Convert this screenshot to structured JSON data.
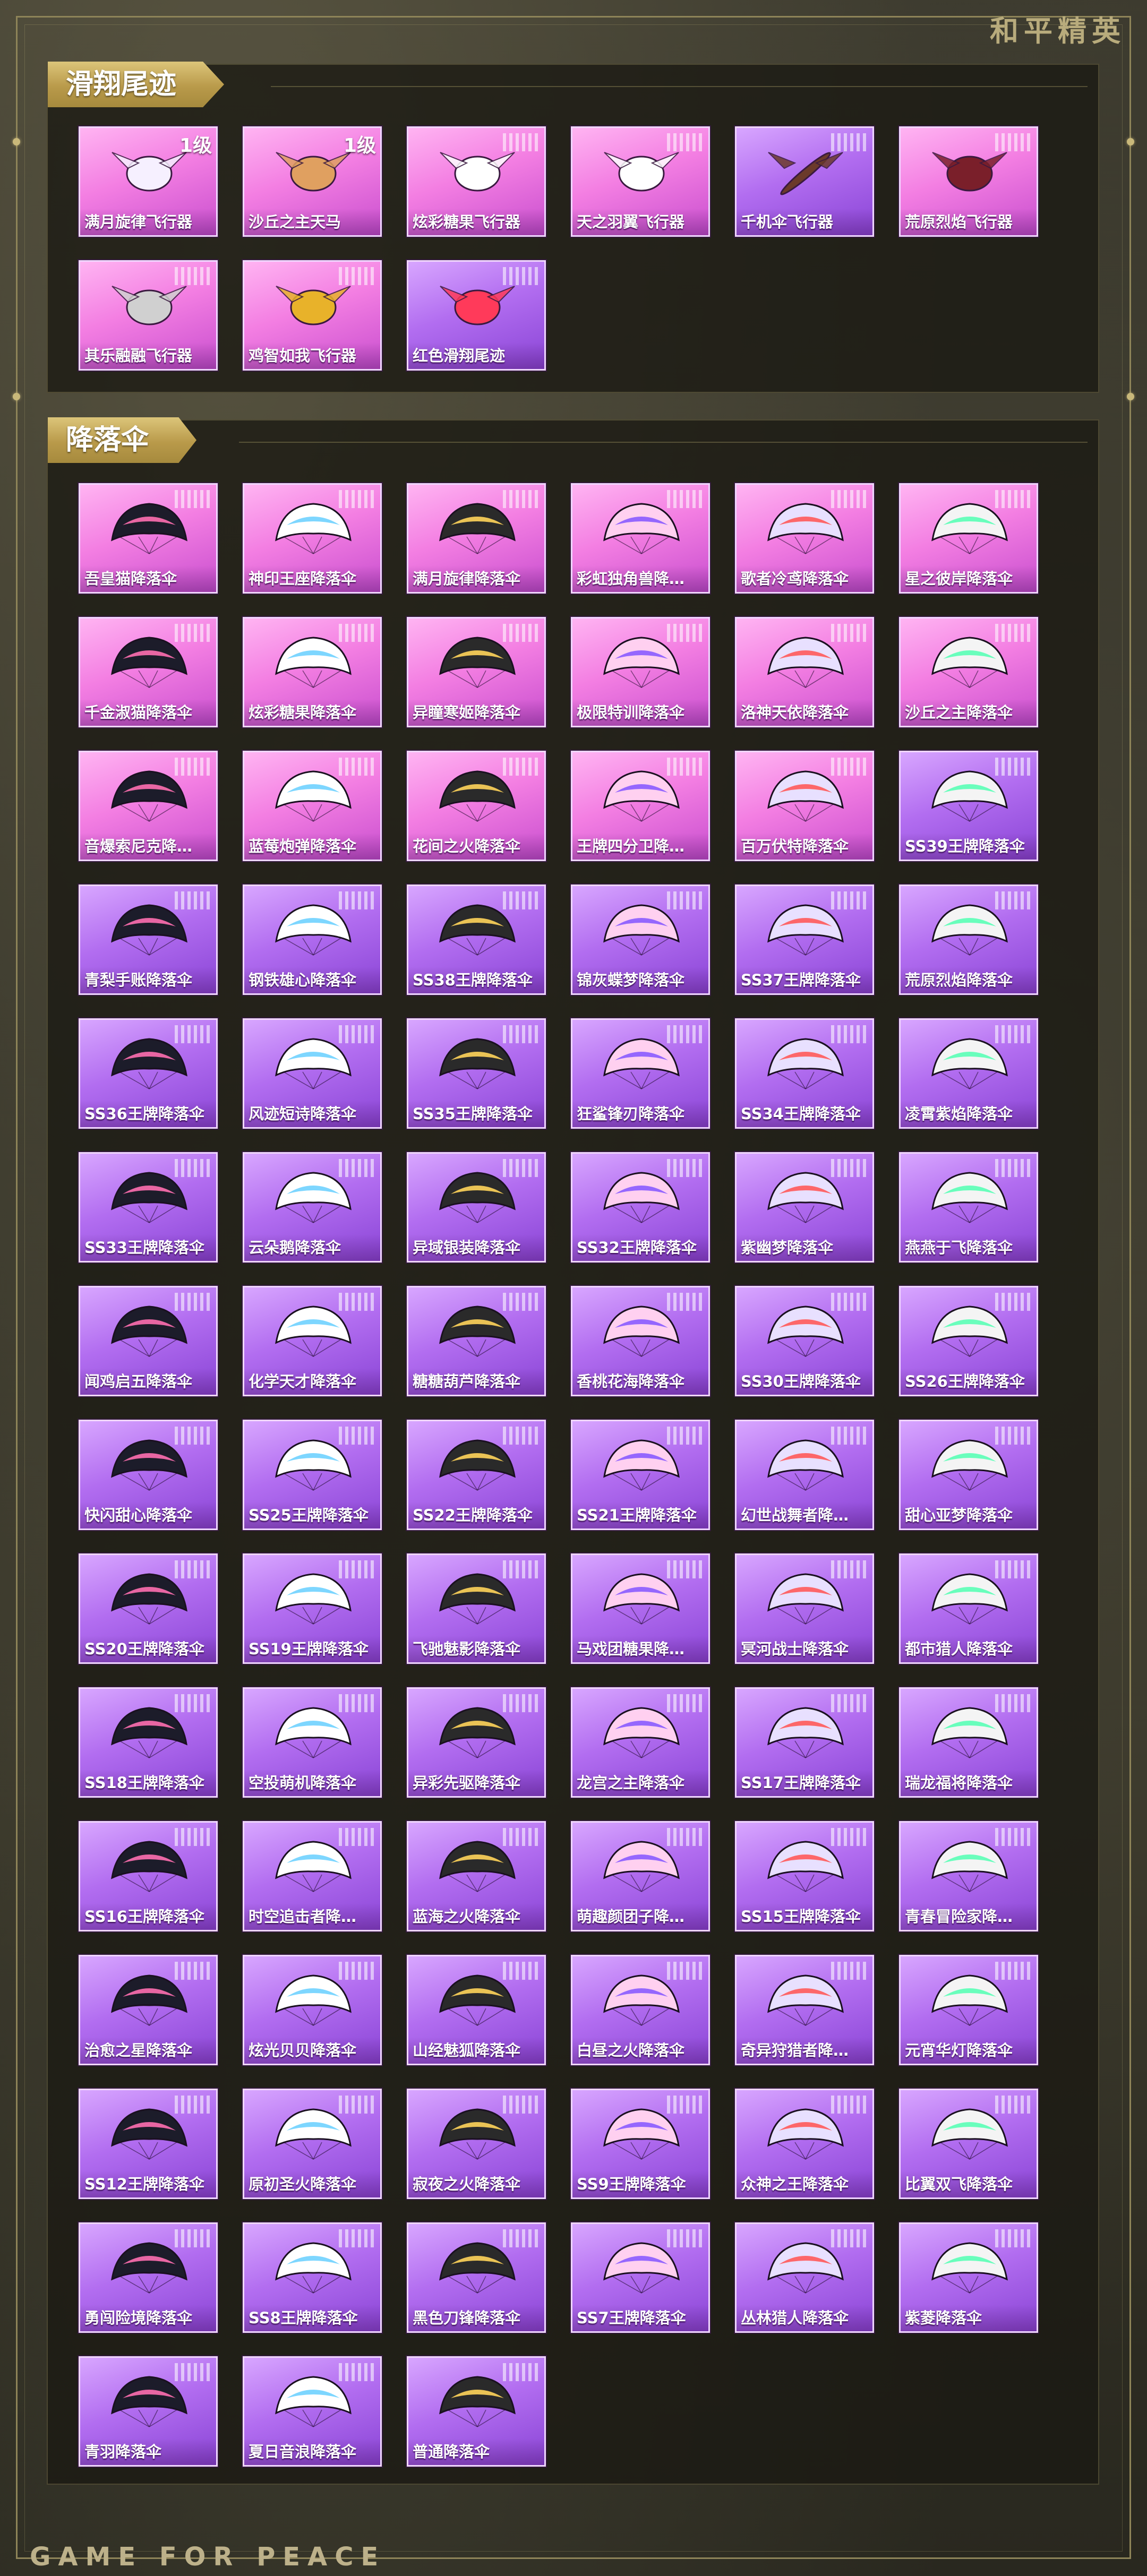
{
  "brand": "和平精英",
  "footer_brand": "GAME FOR PEACE",
  "sections": [
    {
      "title": "滑翔尾迹",
      "items": [
        {
          "name": "满月旋律飞行器",
          "level": "1级",
          "icon": "carriage-glider-icon"
        },
        {
          "name": "沙丘之主天马",
          "level": "1级",
          "icon": "winged-horse-glider-icon"
        },
        {
          "name": "炫彩糖果飞行器",
          "icon": "candy-glider-icon"
        },
        {
          "name": "天之羽翼飞行器",
          "icon": "wing-glider-icon"
        },
        {
          "name": "千机伞飞行器",
          "icon": "umbrella-glider-icon"
        },
        {
          "name": "荒原烈焰飞行器",
          "icon": "flame-glider-icon"
        },
        {
          "name": "其乐融融飞行器",
          "icon": "penguin-glider-icon"
        },
        {
          "name": "鸡智如我飞行器",
          "icon": "chicken-glider-icon"
        },
        {
          "name": "红色滑翔尾迹",
          "icon": "red-trail-icon"
        }
      ]
    },
    {
      "title": "降落伞",
      "items": [
        {
          "name": "吾皇猫降落伞",
          "icon": "parachute-icon"
        },
        {
          "name": "神印王座降落伞",
          "icon": "parachute-icon"
        },
        {
          "name": "满月旋律降落伞",
          "icon": "parachute-icon"
        },
        {
          "name": "彩虹独角兽降…",
          "icon": "parachute-icon"
        },
        {
          "name": "歌者冷鸢降落伞",
          "icon": "parachute-icon"
        },
        {
          "name": "星之彼岸降落伞",
          "icon": "parachute-icon"
        },
        {
          "name": "千金淑猫降落伞",
          "icon": "parachute-icon"
        },
        {
          "name": "炫彩糖果降落伞",
          "icon": "parachute-icon"
        },
        {
          "name": "异瞳寒姬降落伞",
          "icon": "parachute-icon"
        },
        {
          "name": "极限特训降落伞",
          "icon": "parachute-icon"
        },
        {
          "name": "洛神天依降落伞",
          "icon": "parachute-icon"
        },
        {
          "name": "沙丘之主降落伞",
          "icon": "parachute-icon"
        },
        {
          "name": "音爆索尼克降…",
          "icon": "parachute-icon"
        },
        {
          "name": "蓝莓炮弹降落伞",
          "icon": "parachute-icon"
        },
        {
          "name": "花间之火降落伞",
          "icon": "parachute-icon"
        },
        {
          "name": "王牌四分卫降…",
          "icon": "parachute-icon"
        },
        {
          "name": "百万伏特降落伞",
          "icon": "parachute-icon"
        },
        {
          "name": "SS39王牌降落伞",
          "icon": "parachute-icon"
        },
        {
          "name": "青梨手账降落伞",
          "icon": "parachute-icon"
        },
        {
          "name": "钢铁雄心降落伞",
          "icon": "parachute-icon"
        },
        {
          "name": "SS38王牌降落伞",
          "icon": "parachute-icon"
        },
        {
          "name": "锦灰蝶梦降落伞",
          "icon": "parachute-icon"
        },
        {
          "name": "SS37王牌降落伞",
          "icon": "parachute-icon"
        },
        {
          "name": "荒原烈焰降落伞",
          "icon": "parachute-icon"
        },
        {
          "name": "SS36王牌降落伞",
          "icon": "parachute-icon"
        },
        {
          "name": "风迹短诗降落伞",
          "icon": "parachute-icon"
        },
        {
          "name": "SS35王牌降落伞",
          "icon": "parachute-icon"
        },
        {
          "name": "狂鲨锋刃降落伞",
          "icon": "parachute-icon"
        },
        {
          "name": "SS34王牌降落伞",
          "icon": "parachute-icon"
        },
        {
          "name": "凌霄紫焰降落伞",
          "icon": "parachute-icon"
        },
        {
          "name": "SS33王牌降落伞",
          "icon": "parachute-icon"
        },
        {
          "name": "云朵鹅降落伞",
          "icon": "parachute-icon"
        },
        {
          "name": "异域银装降落伞",
          "icon": "parachute-icon"
        },
        {
          "name": "SS32王牌降落伞",
          "icon": "parachute-icon"
        },
        {
          "name": "紫幽梦降落伞",
          "icon": "parachute-icon"
        },
        {
          "name": "燕燕于飞降落伞",
          "icon": "parachute-icon"
        },
        {
          "name": "闻鸡启五降落伞",
          "icon": "parachute-icon"
        },
        {
          "name": "化学天才降落伞",
          "icon": "parachute-icon"
        },
        {
          "name": "糖糖葫芦降落伞",
          "icon": "parachute-icon"
        },
        {
          "name": "香桃花海降落伞",
          "icon": "parachute-icon"
        },
        {
          "name": "SS30王牌降落伞",
          "icon": "parachute-icon"
        },
        {
          "name": "SS26王牌降落伞",
          "icon": "parachute-icon"
        },
        {
          "name": "快闪甜心降落伞",
          "icon": "parachute-icon"
        },
        {
          "name": "SS25王牌降落伞",
          "icon": "parachute-icon"
        },
        {
          "name": "SS22王牌降落伞",
          "icon": "parachute-icon"
        },
        {
          "name": "SS21王牌降落伞",
          "icon": "parachute-icon"
        },
        {
          "name": "幻世战舞者降…",
          "icon": "parachute-icon"
        },
        {
          "name": "甜心亚梦降落伞",
          "icon": "parachute-icon"
        },
        {
          "name": "SS20王牌降落伞",
          "icon": "parachute-icon"
        },
        {
          "name": "SS19王牌降落伞",
          "icon": "parachute-icon"
        },
        {
          "name": "飞驰魅影降落伞",
          "icon": "parachute-icon"
        },
        {
          "name": "马戏团糖果降…",
          "icon": "parachute-icon"
        },
        {
          "name": "冥河战士降落伞",
          "icon": "parachute-icon"
        },
        {
          "name": "都市猎人降落伞",
          "icon": "parachute-icon"
        },
        {
          "name": "SS18王牌降落伞",
          "icon": "parachute-icon"
        },
        {
          "name": "空投萌机降落伞",
          "icon": "parachute-icon"
        },
        {
          "name": "异彩先驱降落伞",
          "icon": "parachute-icon"
        },
        {
          "name": "龙宫之主降落伞",
          "icon": "parachute-icon"
        },
        {
          "name": "SS17王牌降落伞",
          "icon": "parachute-icon"
        },
        {
          "name": "瑞龙福将降落伞",
          "icon": "parachute-icon"
        },
        {
          "name": "SS16王牌降落伞",
          "icon": "parachute-icon"
        },
        {
          "name": "时空追击者降…",
          "icon": "parachute-icon"
        },
        {
          "name": "蓝海之火降落伞",
          "icon": "parachute-icon"
        },
        {
          "name": "萌趣颜团子降…",
          "icon": "parachute-icon"
        },
        {
          "name": "SS15王牌降落伞",
          "icon": "parachute-icon"
        },
        {
          "name": "青春冒险家降…",
          "icon": "parachute-icon"
        },
        {
          "name": "治愈之星降落伞",
          "icon": "parachute-icon"
        },
        {
          "name": "炫光贝贝降落伞",
          "icon": "parachute-icon"
        },
        {
          "name": "山经魅狐降落伞",
          "icon": "parachute-icon"
        },
        {
          "name": "白昼之火降落伞",
          "icon": "parachute-icon"
        },
        {
          "name": "奇异狩猎者降…",
          "icon": "parachute-icon"
        },
        {
          "name": "元宵华灯降落伞",
          "icon": "parachute-icon"
        },
        {
          "name": "SS12王牌降落伞",
          "icon": "parachute-icon"
        },
        {
          "name": "原初圣火降落伞",
          "icon": "parachute-icon"
        },
        {
          "name": "寂夜之火降落伞",
          "icon": "parachute-icon"
        },
        {
          "name": "SS9王牌降落伞",
          "icon": "parachute-icon"
        },
        {
          "name": "众神之王降落伞",
          "icon": "parachute-icon"
        },
        {
          "name": "比翼双飞降落伞",
          "icon": "parachute-icon"
        },
        {
          "name": "勇闯险境降落伞",
          "icon": "parachute-icon"
        },
        {
          "name": "SS8王牌降落伞",
          "icon": "parachute-icon"
        },
        {
          "name": "黑色刀锋降落伞",
          "icon": "parachute-icon"
        },
        {
          "name": "SS7王牌降落伞",
          "icon": "parachute-icon"
        },
        {
          "name": "丛林猎人降落伞",
          "icon": "parachute-icon"
        },
        {
          "name": "紫菱降落伞",
          "icon": "parachute-icon"
        },
        {
          "name": "青羽降落伞",
          "icon": "parachute-icon"
        },
        {
          "name": "夏日音浪降落伞",
          "icon": "parachute-icon"
        },
        {
          "name": "普通降落伞",
          "icon": "parachute-icon"
        }
      ]
    }
  ],
  "colors": {
    "card_pink": "#f37ee2",
    "card_purple": "#b26df0",
    "ribbon_gold": "#c9ad5e",
    "frame_gold": "#8e8458",
    "background": "#2e2d24"
  }
}
